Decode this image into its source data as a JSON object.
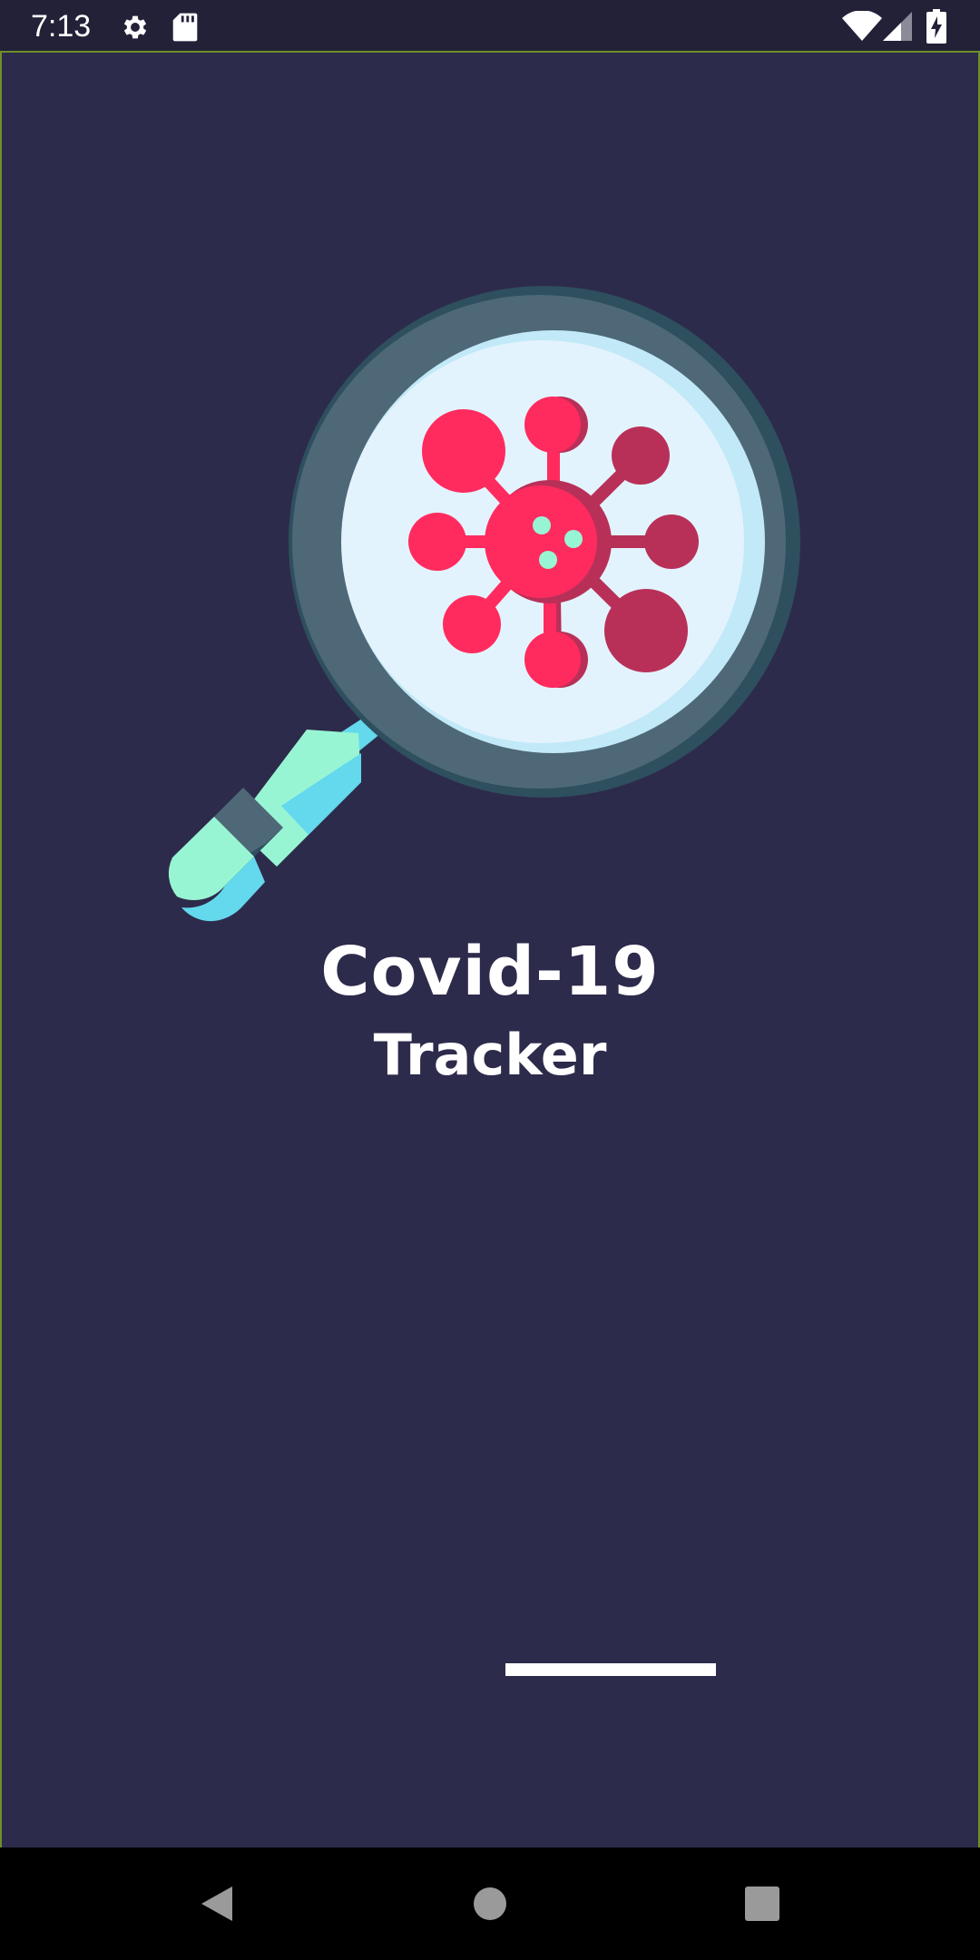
{
  "status_bar": {
    "time": "7:13",
    "icons": [
      "gear-icon",
      "sd-card-icon",
      "wifi-icon",
      "cell-signal-icon",
      "battery-charging-icon"
    ]
  },
  "splash": {
    "logo": "magnifier-virus-icon",
    "title_line1": "Covid-19",
    "title_line2": "Tracker",
    "loading_progress": 0.5
  },
  "nav_bar": {
    "buttons": [
      "back-icon",
      "home-icon",
      "recents-icon"
    ]
  },
  "colors": {
    "background": "#2d2b4b",
    "status_bar": "#222138",
    "virus": "#ff2b5f",
    "virus_shade": "#b83058",
    "lens": "#e3f3fd",
    "rim": "#4e6878",
    "handle_mint": "#98f5d4",
    "handle_cyan": "#64d8ec"
  }
}
